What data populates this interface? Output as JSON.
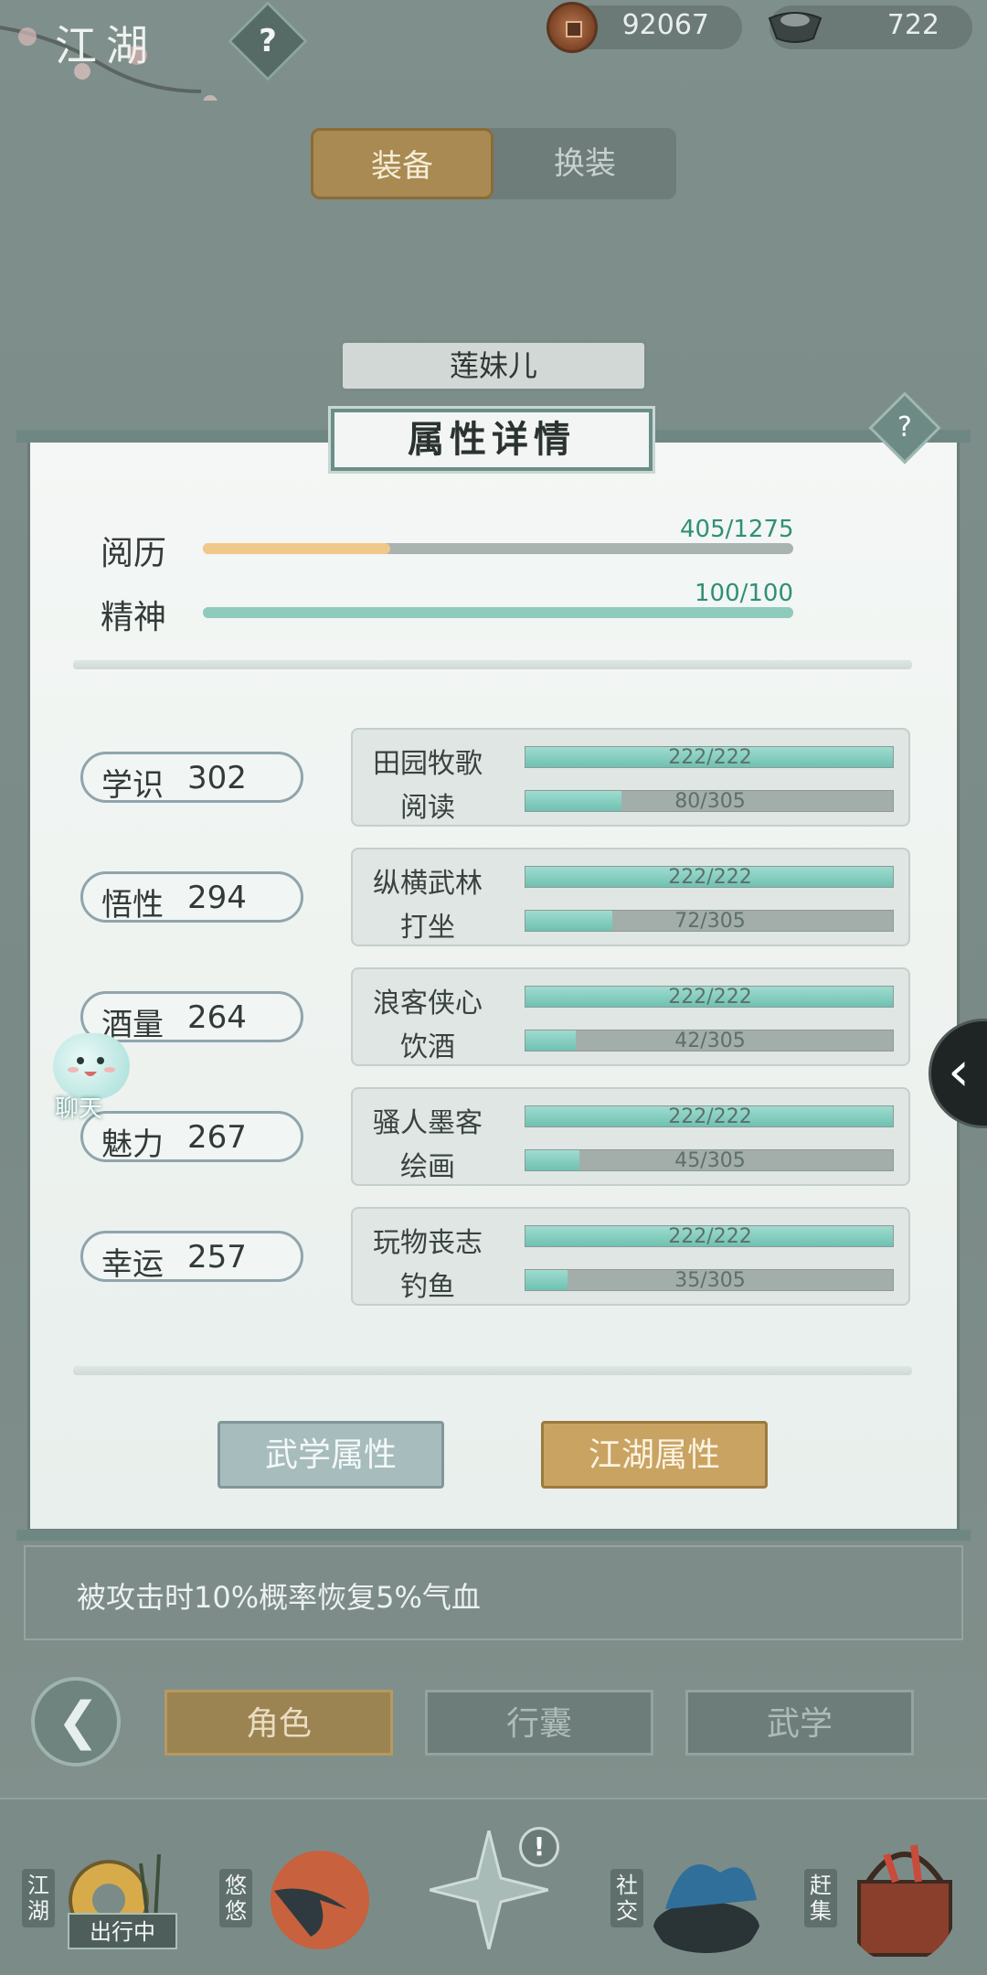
{
  "top": {
    "title": "江湖",
    "help": "?",
    "copper": "92067",
    "silver": "722"
  },
  "tabs": {
    "active": "装备",
    "inactive": "换装"
  },
  "character_name": "莲妹儿",
  "panel": {
    "title": "属性详情",
    "help": "?",
    "experience": {
      "label": "阅历",
      "value": "405/1275",
      "fraction": 0.318
    },
    "spirit": {
      "label": "精神",
      "value": "100/100",
      "fraction": 1.0
    },
    "attributes": [
      {
        "name": "学识",
        "value": "302",
        "skills": [
          {
            "name": "田园牧歌",
            "value": "222/222",
            "fraction": 1.0
          },
          {
            "name": "阅读",
            "value": "80/305",
            "fraction": 0.262
          }
        ]
      },
      {
        "name": "悟性",
        "value": "294",
        "skills": [
          {
            "name": "纵横武林",
            "value": "222/222",
            "fraction": 1.0
          },
          {
            "name": "打坐",
            "value": "72/305",
            "fraction": 0.236
          }
        ]
      },
      {
        "name": "酒量",
        "value": "264",
        "skills": [
          {
            "name": "浪客侠心",
            "value": "222/222",
            "fraction": 1.0
          },
          {
            "name": "饮酒",
            "value": "42/305",
            "fraction": 0.138
          }
        ]
      },
      {
        "name": "魅力",
        "value": "267",
        "skills": [
          {
            "name": "骚人墨客",
            "value": "222/222",
            "fraction": 1.0
          },
          {
            "name": "绘画",
            "value": "45/305",
            "fraction": 0.148
          }
        ]
      },
      {
        "name": "幸运",
        "value": "257",
        "skills": [
          {
            "name": "玩物丧志",
            "value": "222/222",
            "fraction": 1.0
          },
          {
            "name": "钓鱼",
            "value": "35/305",
            "fraction": 0.115
          }
        ]
      }
    ],
    "buttons": {
      "martial": "武学属性",
      "jianghu": "江湖属性"
    }
  },
  "chat_label": "聊天",
  "description": "被攻击时10%概率恢复5%气血",
  "nav": {
    "role": "角色",
    "bag": "行囊",
    "martial": "武学"
  },
  "bottom": {
    "jianghu": "江湖",
    "outing": "出行中",
    "youyou": "悠悠",
    "social": "社交",
    "market": "赶集",
    "alert": "!"
  },
  "colors": {
    "exp_fill": "#f0c98a",
    "spirit_fill": "#8fcbbd",
    "gold_button": "#c9a362",
    "teal_accent": "#2f8f77"
  }
}
